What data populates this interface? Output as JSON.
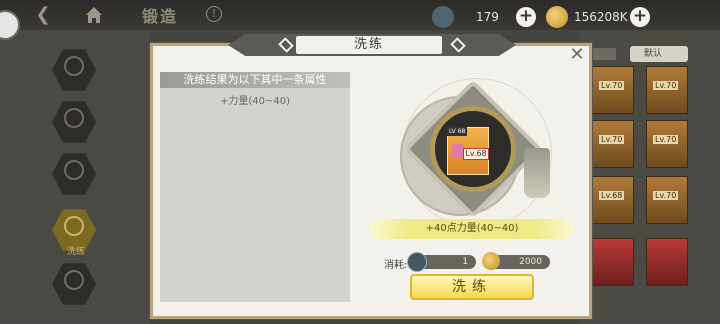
{
  "header": {
    "back_label": "❮",
    "title": "锻造",
    "help_label": "!",
    "currency": [
      {
        "icon": "sword-crystal-icon",
        "value": "179",
        "add_label": "+"
      },
      {
        "icon": "gold-coin-icon",
        "value": "156208K",
        "add_label": "+"
      }
    ]
  },
  "sidebar": {
    "items": [
      {
        "icon": "forge-hex-icon",
        "label": "",
        "active": false
      },
      {
        "icon": "forge-hex-icon",
        "label": "",
        "active": false
      },
      {
        "icon": "forge-hex-icon",
        "label": "",
        "active": false
      },
      {
        "icon": "refine-hex-icon",
        "label": "洗练",
        "active": true
      },
      {
        "icon": "forge-hex-icon",
        "label": "",
        "active": false
      }
    ]
  },
  "inventory": {
    "sort_label": "默认",
    "items": [
      {
        "level": "Lv.70",
        "name": "",
        "color": "#b07b39"
      },
      {
        "level": "Lv.70",
        "name": "",
        "color": "#b07b39"
      },
      {
        "level": "Lv.70",
        "name": "",
        "color": "#b07b39"
      },
      {
        "level": "Lv.70",
        "name": "",
        "color": "#b07b39"
      },
      {
        "level": "Lv.68",
        "name": "",
        "color": "#b07b39"
      },
      {
        "level": "Lv.70",
        "name": "",
        "color": "#b07b39"
      },
      {
        "level": "",
        "name": "",
        "color": "#b73b38"
      },
      {
        "level": "",
        "name": "",
        "color": "#b73b38"
      }
    ]
  },
  "modal": {
    "title": "洗练",
    "close_label": "✕",
    "result_header": "洗练结果为以下其中一条属性",
    "result_lines": [
      "+力量(40~40)"
    ],
    "item_card": {
      "top_tag": "LV 68",
      "level": "Lv.68"
    },
    "current_attr": "+40点力量(40~40)",
    "cost_label": "消耗:",
    "costs": [
      {
        "icon": "sword-crystal-icon",
        "value": "1"
      },
      {
        "icon": "gold-coin-icon",
        "value": "2000"
      }
    ],
    "action_label": "洗练"
  }
}
